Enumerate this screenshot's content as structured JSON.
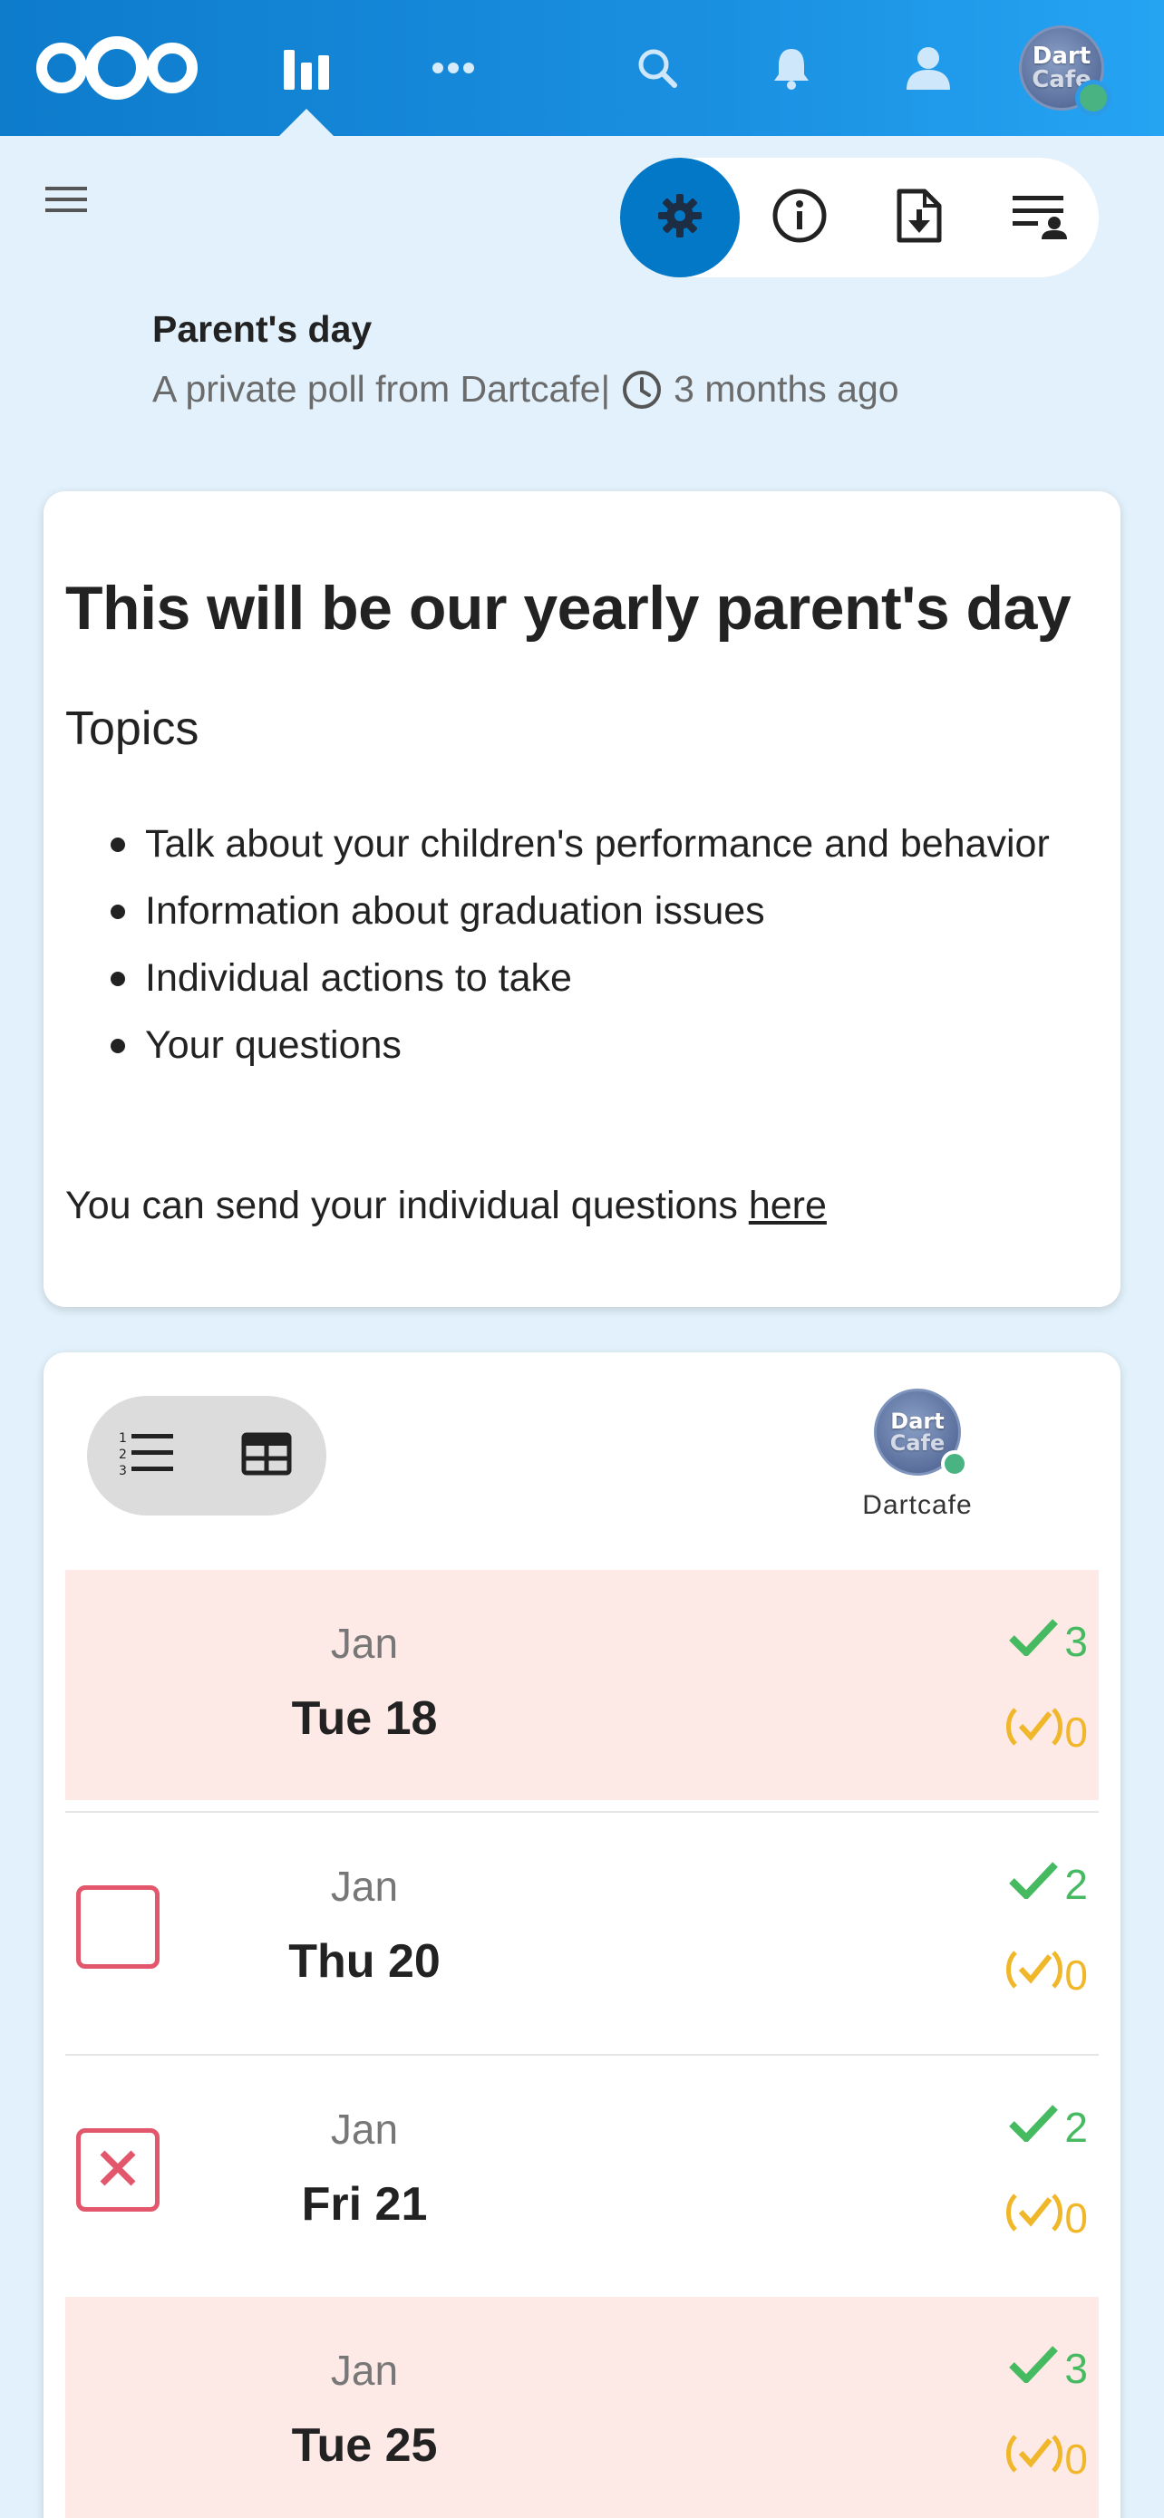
{
  "header": {
    "logo_icon": "nextcloud-logo-icon",
    "avatar_initials_line1": "Dart",
    "avatar_initials_line2": "Cafe"
  },
  "poll": {
    "title": "Parent's day",
    "meta_prefix": "A private poll from Dartcafe",
    "meta_separator": "|",
    "meta_time": "3 months ago"
  },
  "description": {
    "heading": "This will be our yearly parent's day",
    "subheading": "Topics",
    "topics": [
      "Talk about your children's performance and behavior",
      "Information about graduation issues",
      "Individual actions to take",
      "Your questions"
    ],
    "footer_text": "You can send your individual questions ",
    "footer_link": "here"
  },
  "participant": {
    "name": "Dartcafe",
    "avatar_line1": "Dart",
    "avatar_line2": "Cafe"
  },
  "options": [
    {
      "month": "Jan",
      "day": "Tue 18",
      "yes": "3",
      "maybe": "0",
      "vote": "none",
      "highlight": true
    },
    {
      "month": "Jan",
      "day": "Thu 20",
      "yes": "2",
      "maybe": "0",
      "vote": "empty",
      "highlight": false
    },
    {
      "month": "Jan",
      "day": "Fri 21",
      "yes": "2",
      "maybe": "0",
      "vote": "no",
      "highlight": false
    },
    {
      "month": "Jan",
      "day": "Tue 25",
      "yes": "3",
      "maybe": "0",
      "vote": "none",
      "highlight": true
    }
  ],
  "colors": {
    "header_start": "#0e7bcb",
    "header_end": "#25a4f3",
    "primary": "#0278c6",
    "yes": "#46ba61",
    "maybe": "#f0b72a",
    "no": "#e3576d",
    "highlight_row": "#fde9e6",
    "page_bg": "#e2f1fb"
  }
}
